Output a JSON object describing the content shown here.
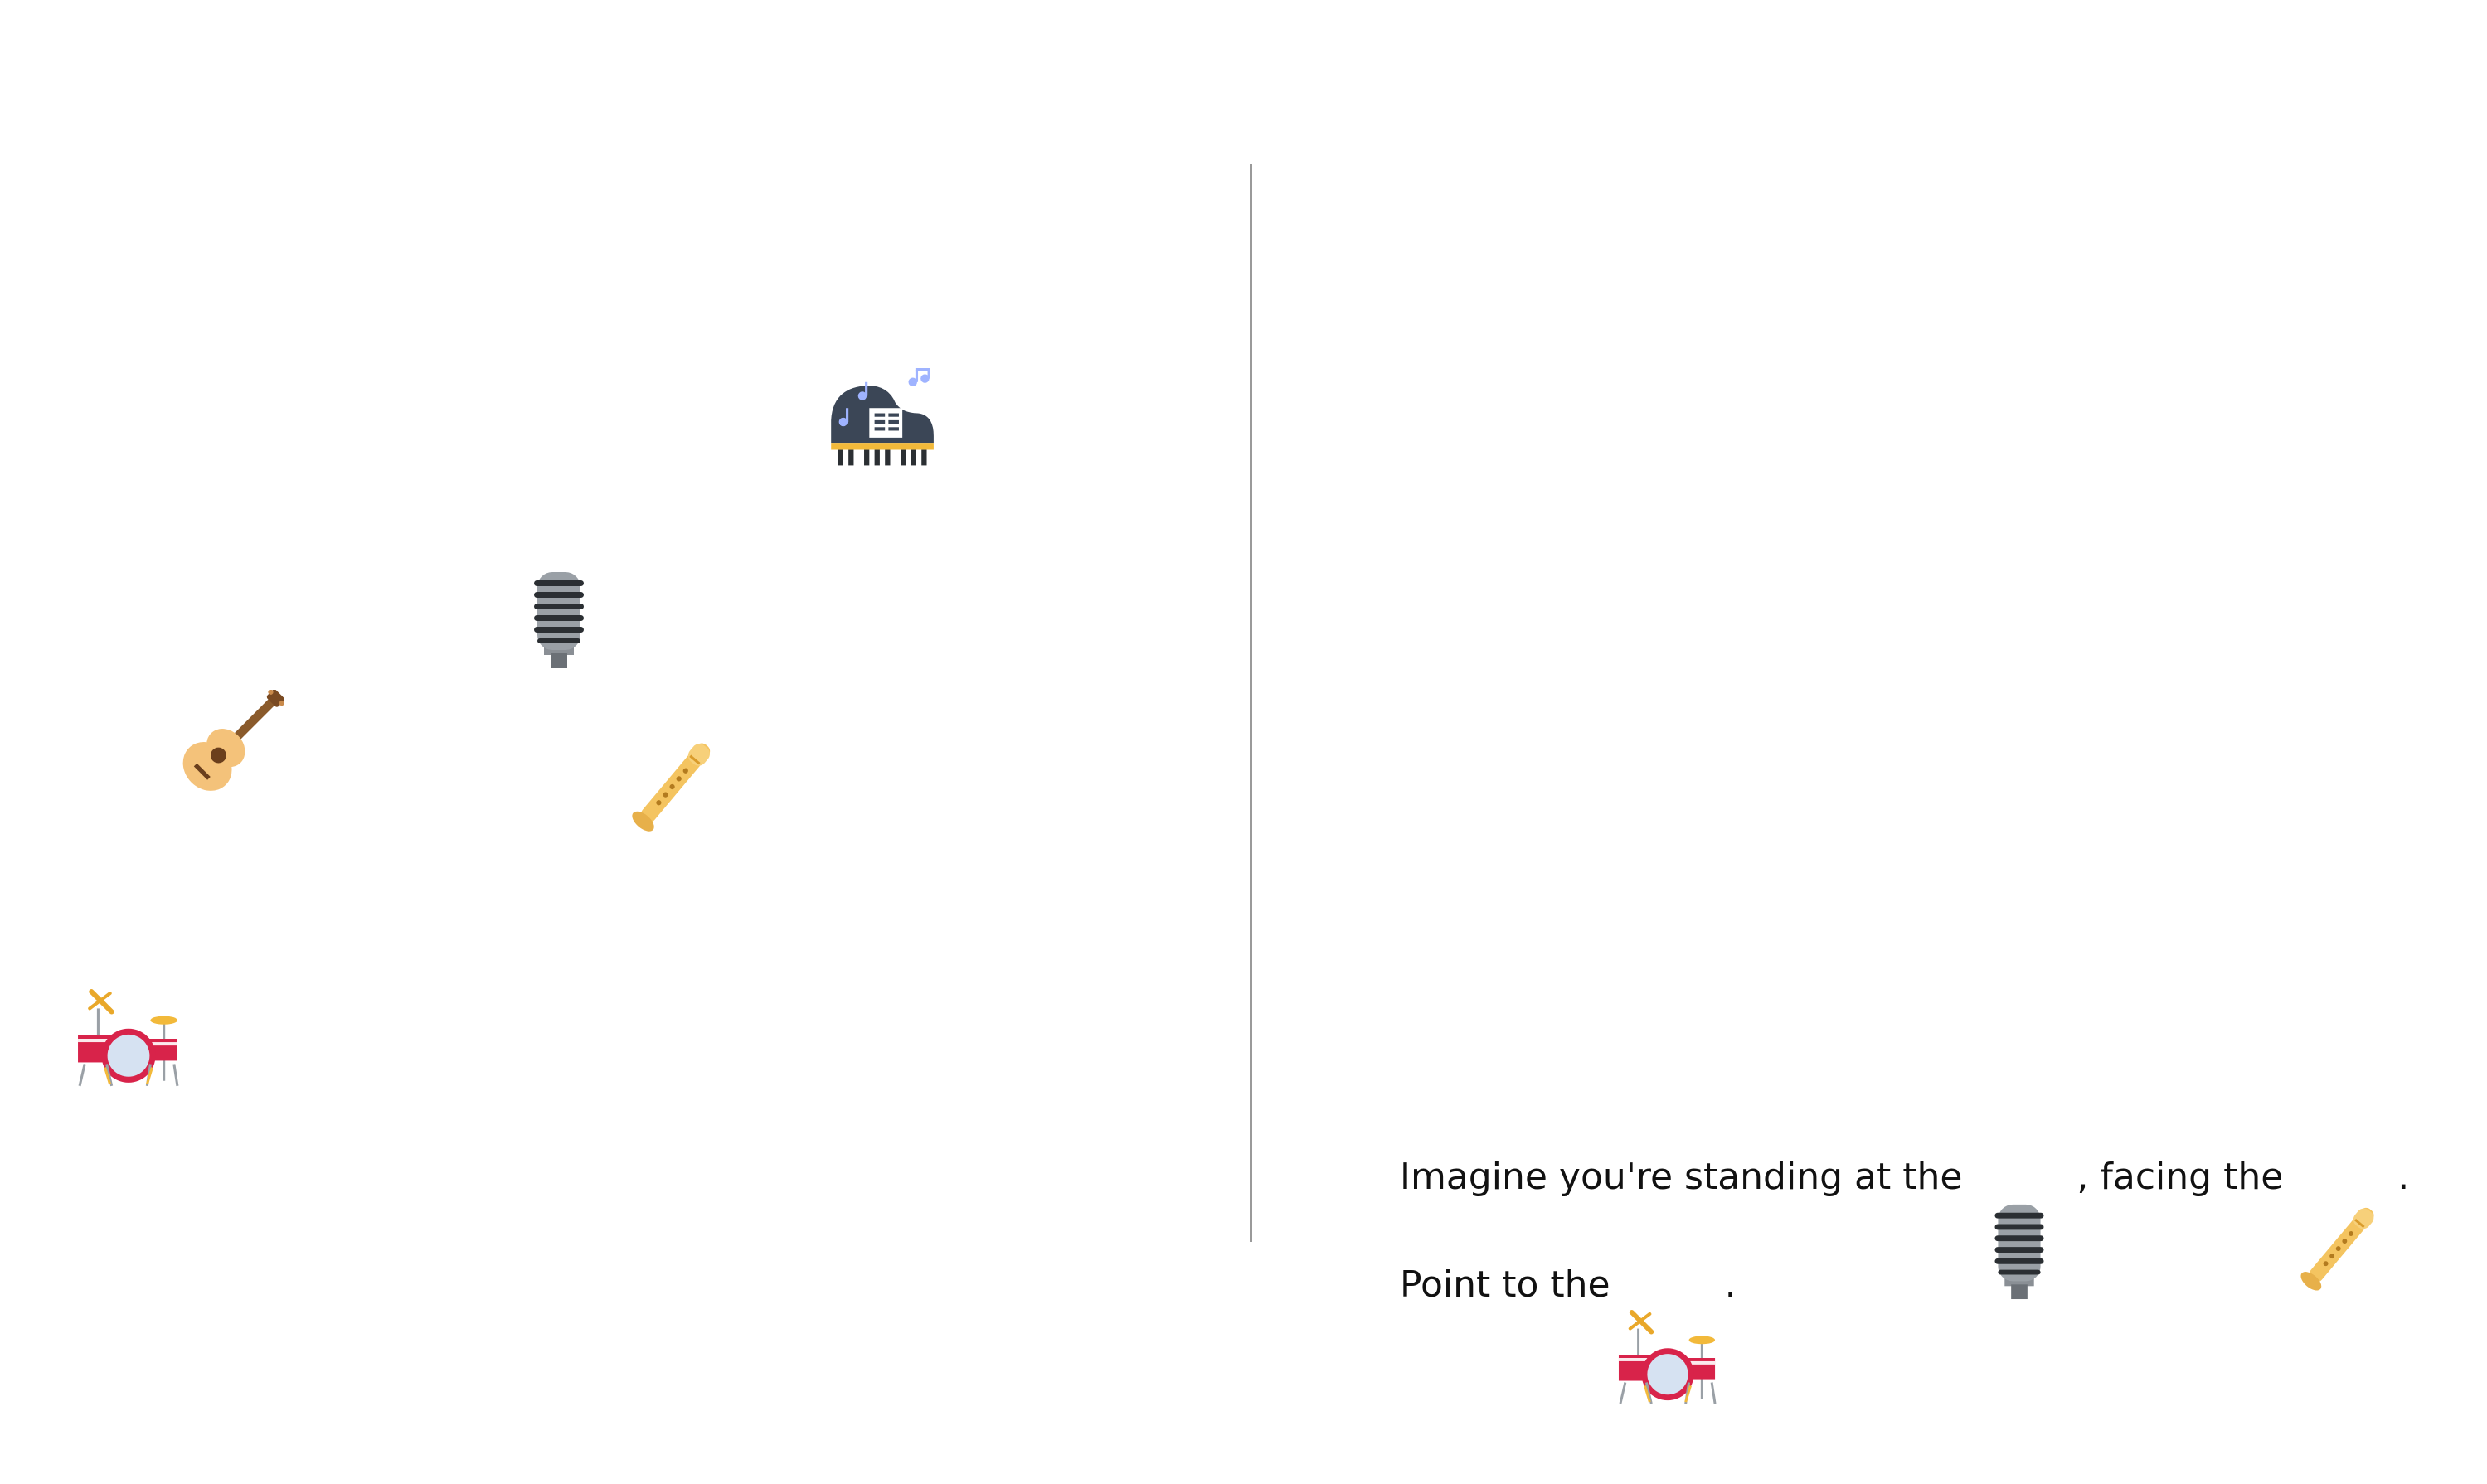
{
  "scene": {
    "items": [
      {
        "name": "piano",
        "icon": "grand-piano-icon"
      },
      {
        "name": "microphone",
        "icon": "microphone-icon"
      },
      {
        "name": "guitar",
        "icon": "guitar-icon"
      },
      {
        "name": "flute",
        "icon": "flute-icon"
      },
      {
        "name": "drums",
        "icon": "drum-kit-icon"
      }
    ]
  },
  "prompt": {
    "part1": "Imagine you're standing at the",
    "part2": ", facing the",
    "part3": ".",
    "part4": "Point to the",
    "part5": ".",
    "standing_icon": "microphone-icon",
    "facing_icon": "flute-icon",
    "target_icon": "drum-kit-icon"
  },
  "colors": {
    "divider": "#9a9a9a",
    "text": "#111111"
  }
}
